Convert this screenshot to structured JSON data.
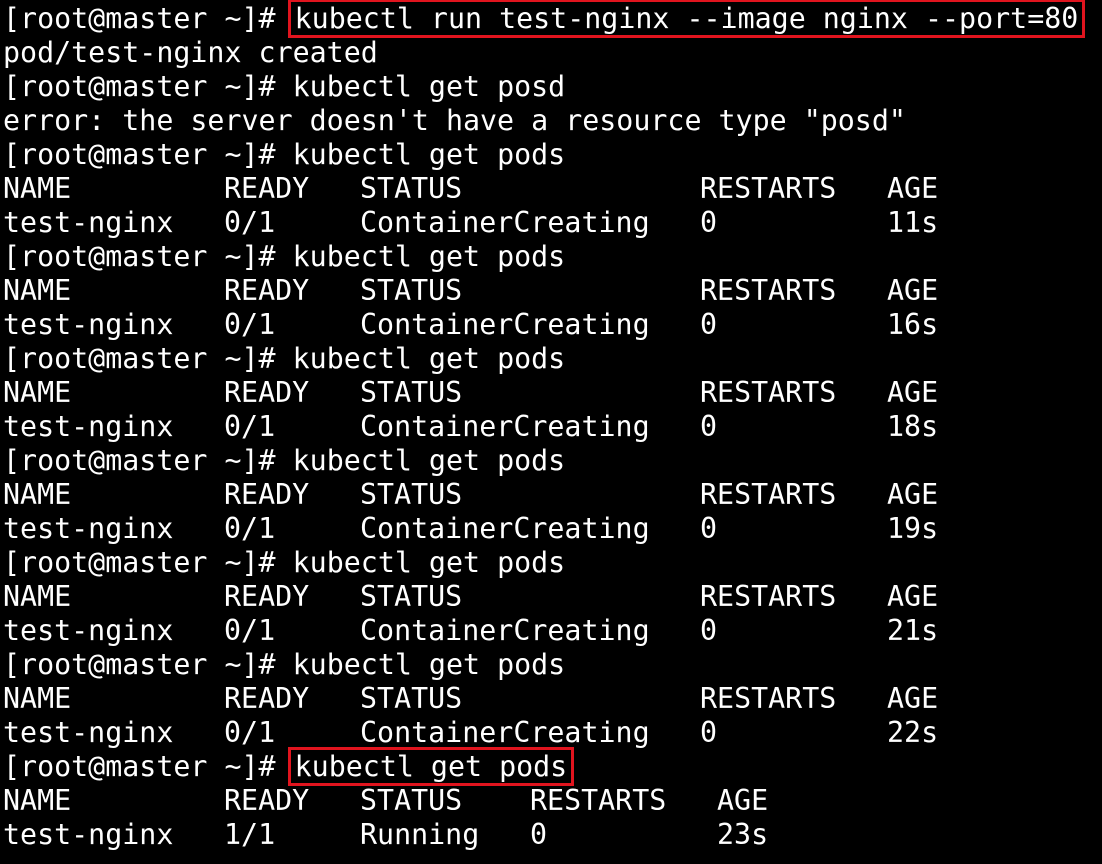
{
  "prompt": "[root@master ~]#",
  "commands": {
    "run": "kubectl run test-nginx --image nginx --port=80",
    "typo": "kubectl get posd",
    "get": "kubectl get pods"
  },
  "outputs": {
    "created": "pod/test-nginx created",
    "error": "error: the server doesn't have a resource type \"posd\""
  },
  "table": {
    "headers": [
      "NAME",
      "READY",
      "STATUS",
      "RESTARTS",
      "AGE"
    ]
  },
  "pod_rows": [
    {
      "name": "test-nginx",
      "ready": "0/1",
      "status": "ContainerCreating",
      "restarts": "0",
      "age": "11s"
    },
    {
      "name": "test-nginx",
      "ready": "0/1",
      "status": "ContainerCreating",
      "restarts": "0",
      "age": "16s"
    },
    {
      "name": "test-nginx",
      "ready": "0/1",
      "status": "ContainerCreating",
      "restarts": "0",
      "age": "18s"
    },
    {
      "name": "test-nginx",
      "ready": "0/1",
      "status": "ContainerCreating",
      "restarts": "0",
      "age": "19s"
    },
    {
      "name": "test-nginx",
      "ready": "0/1",
      "status": "ContainerCreating",
      "restarts": "0",
      "age": "21s"
    },
    {
      "name": "test-nginx",
      "ready": "0/1",
      "status": "ContainerCreating",
      "restarts": "0",
      "age": "22s"
    }
  ],
  "final_row": {
    "name": "test-nginx",
    "ready": "1/1",
    "status": "Running",
    "restarts": "0",
    "age": "23s"
  },
  "colors": {
    "background": "#000000",
    "text": "#ffffff",
    "highlight_box": "#e0141e"
  }
}
